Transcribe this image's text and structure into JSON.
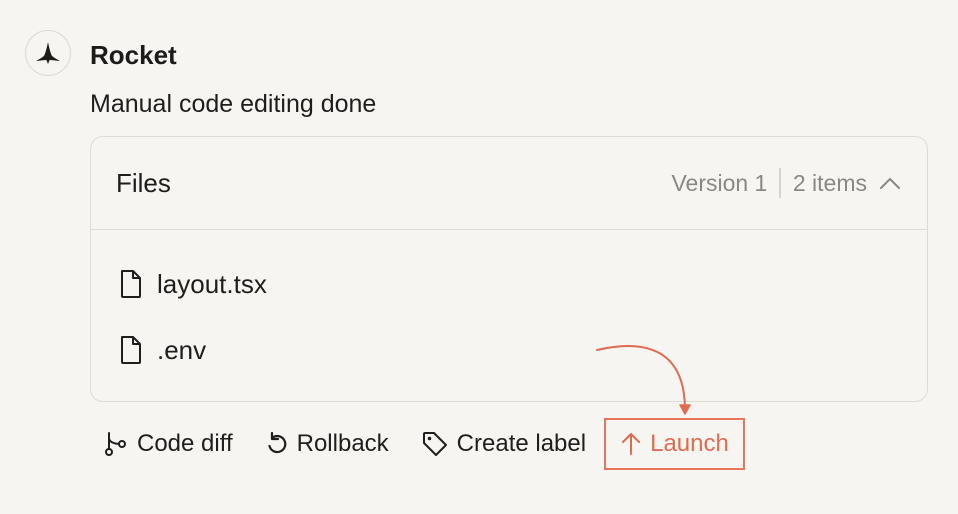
{
  "message_author": "Rocket",
  "message_text": "Manual code editing done",
  "files_panel": {
    "title": "Files",
    "version_label": "Version 1",
    "item_count": "2 items",
    "collapse_icon": "chevron-up-icon",
    "files": [
      {
        "name": "layout.tsx",
        "icon": "file-icon"
      },
      {
        "name": ".env",
        "icon": "file-icon"
      }
    ]
  },
  "actions": {
    "code_diff": "Code diff",
    "rollback": "Rollback",
    "create_label": "Create label",
    "launch": "Launch"
  },
  "colors": {
    "accent": "#e06b4e",
    "background": "#f6f5f2",
    "border": "#dedcd7",
    "muted_text": "#8a8883"
  }
}
